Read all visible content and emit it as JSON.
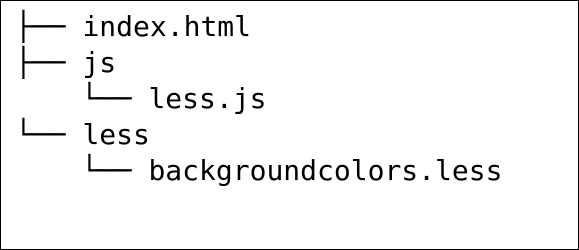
{
  "tree": {
    "items": [
      {
        "connector": "├── ",
        "label": "index.html"
      },
      {
        "connector": "├── ",
        "label": "js"
      },
      {
        "connector": "└── ",
        "label": "less.js"
      },
      {
        "connector": "└── ",
        "label": "less"
      },
      {
        "connector": "└── ",
        "label": "backgroundcolors.less"
      }
    ]
  }
}
